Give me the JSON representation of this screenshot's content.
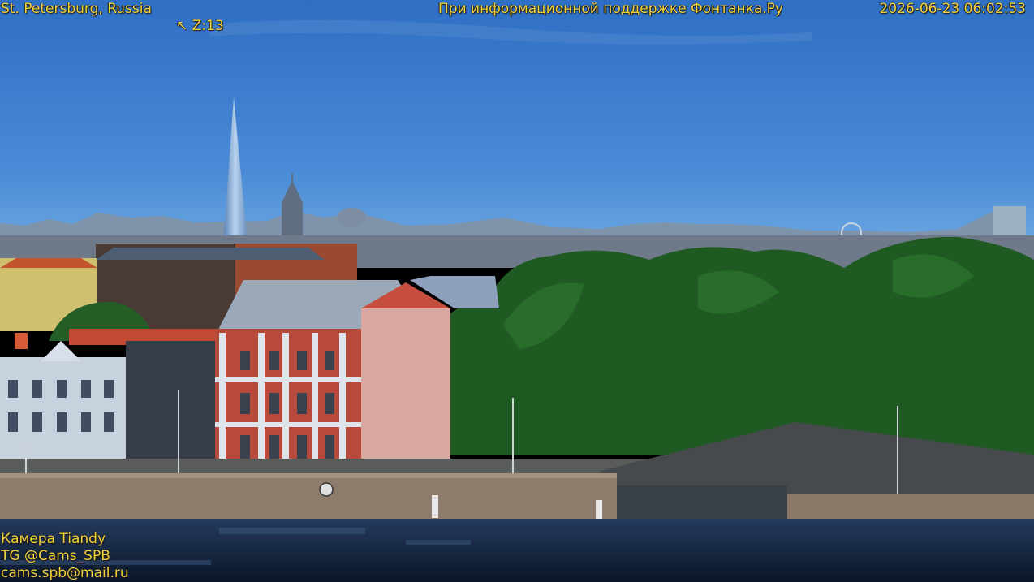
{
  "overlay": {
    "location": "St. Petersburg, Russia",
    "zoom_arrow": "↖",
    "zoom_level": "Z:13",
    "sponsor": "При информационной поддержке Фонтанка.Ру",
    "timestamp": "2026-06-23 06:02:53",
    "camera": "Камера Tiandy",
    "telegram": "TG @Cams_SPB",
    "email": "cams.spb@mail.ru"
  },
  "colors": {
    "overlay_text": "#f2d23a",
    "sky_top": "#2f6fc4",
    "sky_horizon": "#6aa6e0",
    "trees": "#1f5a22",
    "water": "#0e1e36",
    "embankment": "#8d7c6c",
    "building_facade": "#b84a3c",
    "tower": "#8fb2d6"
  }
}
